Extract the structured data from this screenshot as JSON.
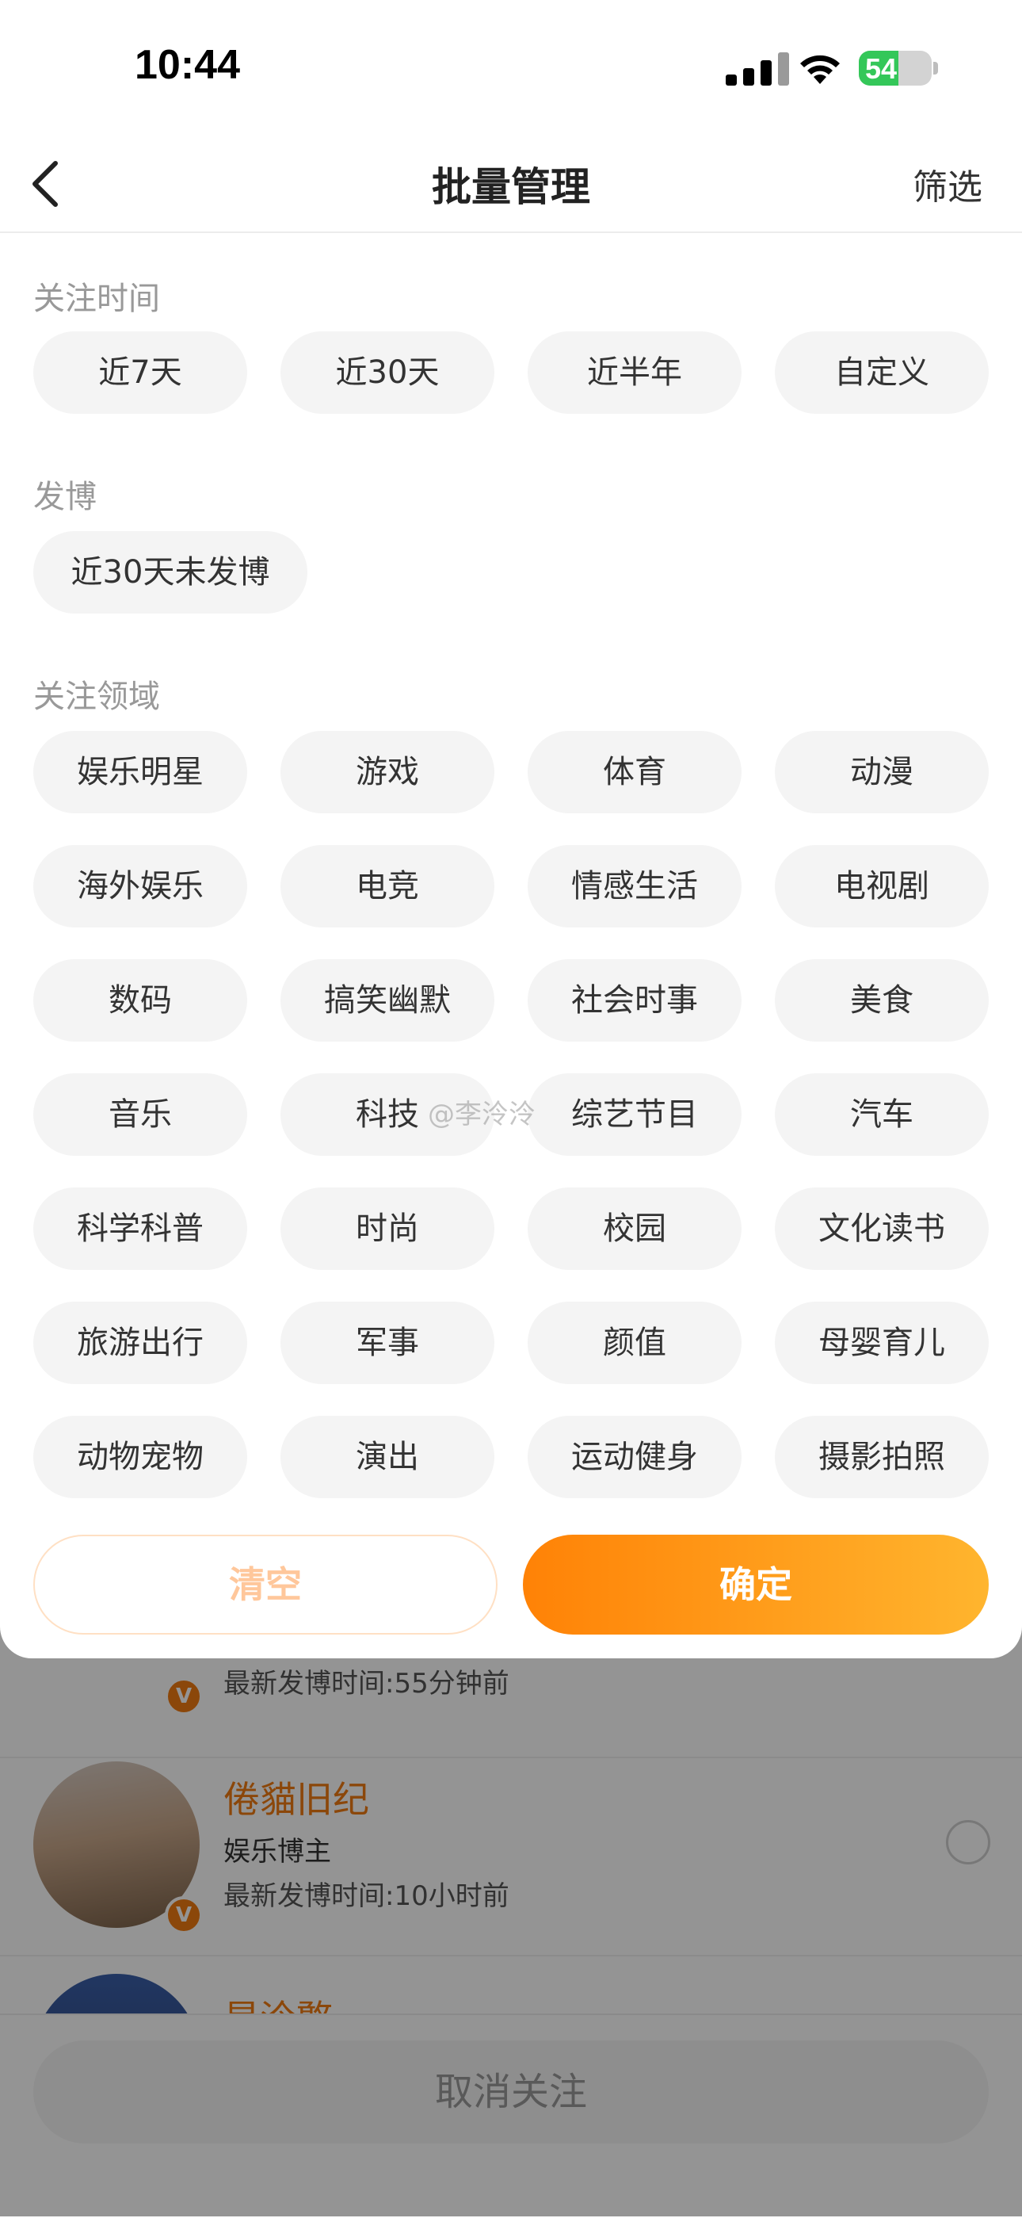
{
  "status_bar": {
    "time": "10:44",
    "battery": "54",
    "battery_level": 0.54
  },
  "header": {
    "title": "批量管理",
    "filter": "筛选"
  },
  "filter_sheet": {
    "follow_time": {
      "title": "关注时间",
      "options": [
        "近7天",
        "近30天",
        "近半年",
        "自定义"
      ]
    },
    "posting": {
      "title": "发博",
      "options": [
        "近30天未发博"
      ]
    },
    "domains": {
      "title": "关注领域",
      "options": [
        "娱乐明星",
        "游戏",
        "体育",
        "动漫",
        "海外娱乐",
        "电竞",
        "情感生活",
        "电视剧",
        "数码",
        "搞笑幽默",
        "社会时事",
        "美食",
        "音乐",
        "科技",
        "综艺节目",
        "汽车",
        "科学科普",
        "时尚",
        "校园",
        "文化读书",
        "旅游出行",
        "军事",
        "颜值",
        "母婴育儿",
        "动物宠物",
        "演出",
        "运动健身",
        "摄影拍照"
      ]
    },
    "clear_label": "清空",
    "confirm_label": "确定"
  },
  "user_list": [
    {
      "time": "最新发博时间:55分钟前",
      "verified_badge": "V"
    },
    {
      "name": "倦貓旧纪",
      "desc": "娱乐博主",
      "time": "最新发博时间:10小时前",
      "verified_badge": "V"
    },
    {
      "name": "星泠憨"
    }
  ],
  "bottom": {
    "unfollow_label": "取消关注"
  },
  "watermark": "@李泠泠",
  "colors": {
    "accent": "#f07b12",
    "confirm_start": "#ff8206",
    "confirm_end": "#ffb52e",
    "chip_bg": "#f4f4f4"
  }
}
